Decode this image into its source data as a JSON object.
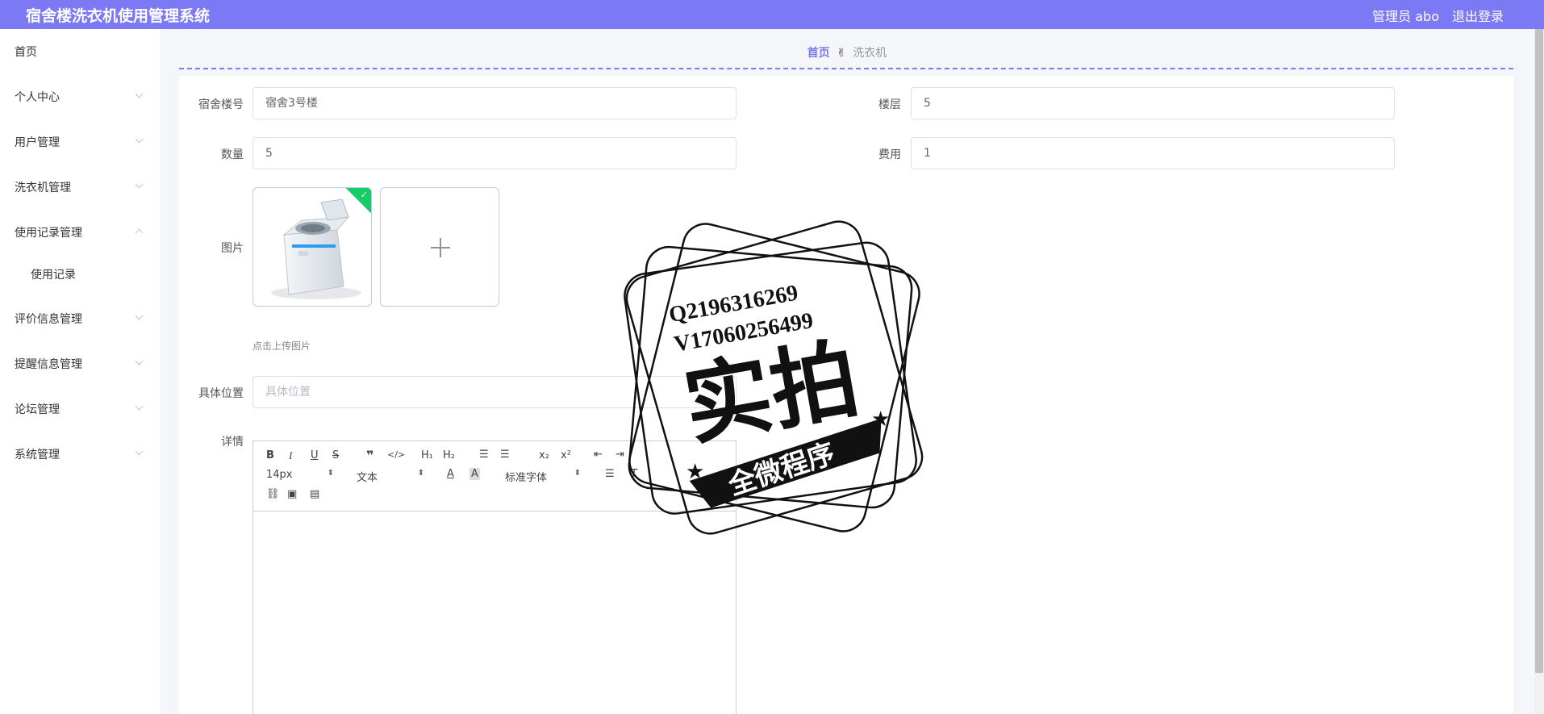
{
  "header": {
    "title": "宿舍楼洗衣机使用管理系统",
    "admin": "管理员 abo",
    "logout": "退出登录"
  },
  "sidebar": {
    "items": [
      {
        "label": "首页"
      },
      {
        "label": "个人中心"
      },
      {
        "label": "用户管理"
      },
      {
        "label": "洗衣机管理"
      },
      {
        "label": "使用记录管理"
      },
      {
        "label": "使用记录"
      },
      {
        "label": "评价信息管理"
      },
      {
        "label": "提醒信息管理"
      },
      {
        "label": "论坛管理"
      },
      {
        "label": "系统管理"
      }
    ]
  },
  "breadcrumb": {
    "home": "首页",
    "current": "洗衣机"
  },
  "form": {
    "building_label": "宿舍楼号",
    "building_value": "宿舍3号楼",
    "floor_label": "楼层",
    "floor_value": "5",
    "quantity_label": "数量",
    "quantity_value": "5",
    "fee_label": "费用",
    "fee_value": "1",
    "image_label": "图片",
    "upload_tip": "点击上传图片",
    "location_label": "具体位置",
    "location_placeholder": "具体位置",
    "details_label": "详情"
  },
  "editor": {
    "font_size": "14px",
    "paragraph": "文本",
    "font_family": "标准字体"
  },
  "stamp": {
    "line1": "Q2196316269",
    "line2": "V17060256499",
    "main": "实拍",
    "banner": "全微程序"
  },
  "colors": {
    "accent": "#7b79f3",
    "success": "#13ce66"
  }
}
